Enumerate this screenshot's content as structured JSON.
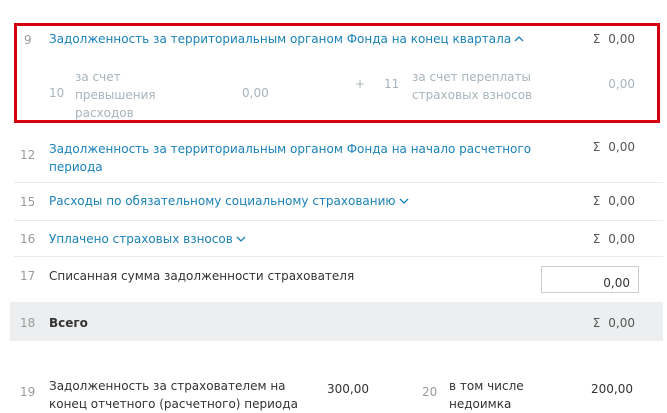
{
  "rows": {
    "r9": {
      "num": "9",
      "label": "Задолженность за территориальным органом Фонда на конец квартала",
      "value": "0,00",
      "sigma": "Σ"
    },
    "r10": {
      "num": "10",
      "label_line1": "за счет",
      "label_line2": "превышения",
      "label_line3": "расходов",
      "value": "0,00"
    },
    "plus": "+",
    "r11": {
      "num": "11",
      "label_line1": "за счет переплаты",
      "label_line2": "страховых взносов",
      "value": "0,00"
    },
    "r12": {
      "num": "12",
      "label_line1": "Задолженность за территориальным органом Фонда на начало расчетного",
      "label_line2": "периода",
      "value": "0,00",
      "sigma": "Σ"
    },
    "r15": {
      "num": "15",
      "label": "Расходы по обязательному социальному страхованию",
      "value": "0,00",
      "sigma": "Σ"
    },
    "r16": {
      "num": "16",
      "label": "Уплачено страховых взносов",
      "value": "0,00",
      "sigma": "Σ"
    },
    "r17": {
      "num": "17",
      "label": "Списанная сумма задолженности страхователя",
      "input_value": "0,00"
    },
    "r18": {
      "num": "18",
      "label": "Всего",
      "value": "0,00",
      "sigma": "Σ"
    },
    "r19": {
      "num": "19",
      "label_line1": "Задолженность за страхователем на",
      "label_line2": "конец отчетного (расчетного) периода",
      "value": "300,00"
    },
    "r20": {
      "num": "20",
      "label_line1": "в том числе",
      "label_line2": "недоимка",
      "value": "200,00"
    }
  },
  "colors": {
    "link": "#1a82b8",
    "highlight": "#d6000f",
    "muted": "#a8b4bb"
  },
  "icons": {
    "collapse": "chevron-up-icon",
    "expand": "chevron-down-icon"
  }
}
